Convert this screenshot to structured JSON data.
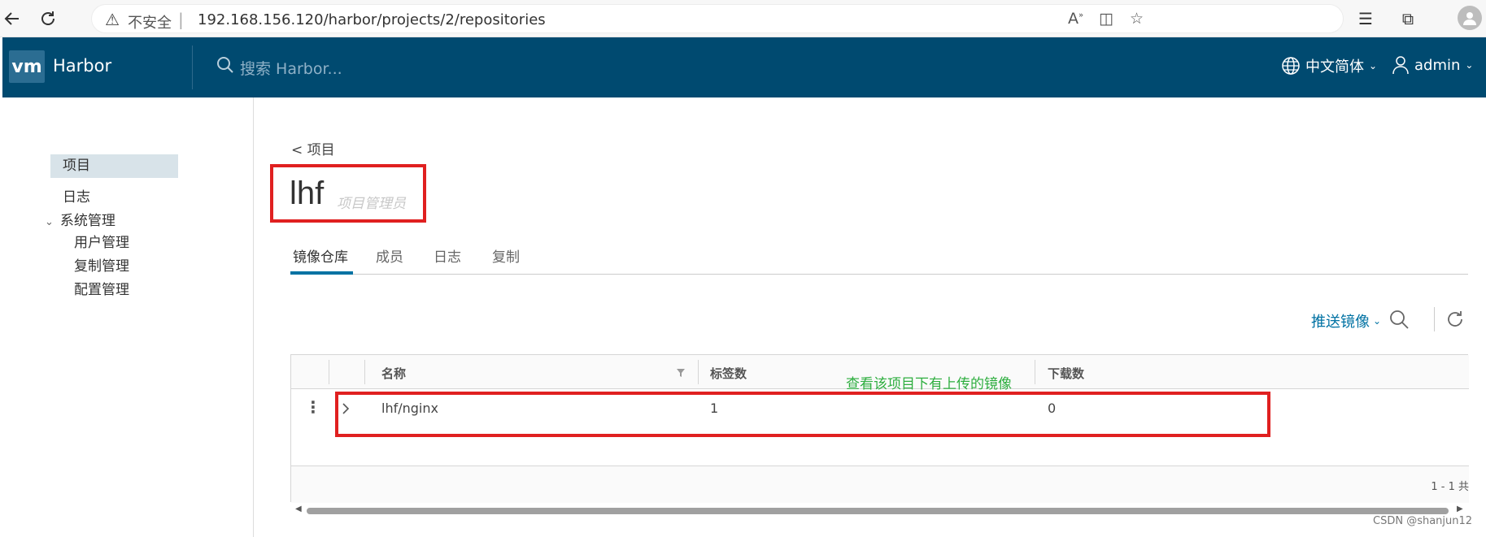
{
  "browser": {
    "insecure_label": "不安全",
    "separator": "|",
    "url": "192.168.156.120/harbor/projects/2/repositories"
  },
  "header": {
    "brand": "Harbor",
    "logo_text": "vm",
    "search_placeholder": "搜索 Harbor...",
    "language": "中文简体",
    "user": "admin"
  },
  "sidebar": {
    "items": [
      {
        "label": "项目"
      },
      {
        "label": "日志"
      },
      {
        "label": "系统管理"
      },
      {
        "label": "用户管理"
      },
      {
        "label": "复制管理"
      },
      {
        "label": "配置管理"
      }
    ]
  },
  "main": {
    "back_label": "< 项目",
    "project_name": "lhf",
    "project_role": "项目管理员",
    "tabs": [
      {
        "label": "镜像仓库"
      },
      {
        "label": "成员"
      },
      {
        "label": "日志"
      },
      {
        "label": "复制"
      }
    ],
    "push_button": "推送镜像",
    "grid": {
      "columns": [
        "名称",
        "标签数",
        "下载数"
      ],
      "rows": [
        {
          "name": "lhf/nginx",
          "tags": "1",
          "pulls": "0"
        }
      ],
      "pagination": "1 - 1 共"
    }
  },
  "annotation": "查看该项目下有上传的镜像",
  "watermark": "CSDN @shanjun12",
  "colors": {
    "header_bg": "#004a70",
    "accent": "#0072a3",
    "highlight_red": "#e02020",
    "annotation_green": "#2eae3f"
  }
}
